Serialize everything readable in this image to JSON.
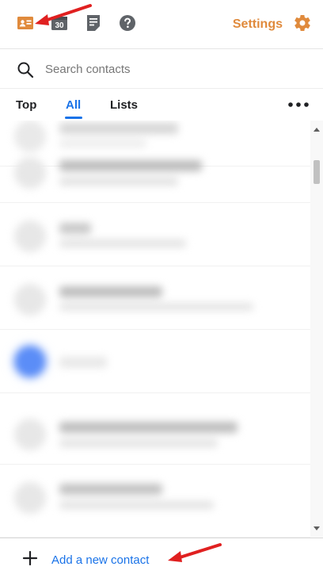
{
  "toolbar": {
    "icons": [
      {
        "name": "contacts-icon",
        "color": "#e08a3c"
      },
      {
        "name": "calendar-icon",
        "text": "30",
        "color": "#5f6368"
      },
      {
        "name": "tasks-icon",
        "color": "#5f6368"
      },
      {
        "name": "help-icon",
        "color": "#5f6368"
      }
    ],
    "settings_label": "Settings",
    "settings_icon": "gear-icon",
    "accent_color": "#e08a3c"
  },
  "search": {
    "icon": "search-icon",
    "placeholder": "Search contacts",
    "value": ""
  },
  "tabs": [
    {
      "label": "Top",
      "active": false
    },
    {
      "label": "All",
      "active": true
    },
    {
      "label": "Lists",
      "active": false
    }
  ],
  "more_menu_icon": "more-horizontal-icon",
  "contacts_note": "Contact entries are blurred in the screenshot; names are not legible.",
  "footer": {
    "add_icon": "plus-icon",
    "add_label": "Add a new contact",
    "link_color": "#1a73e8"
  },
  "annotations": {
    "arrow_color": "#e02020",
    "arrows": [
      "arrow-to-contacts-icon",
      "arrow-to-add-contact"
    ]
  }
}
